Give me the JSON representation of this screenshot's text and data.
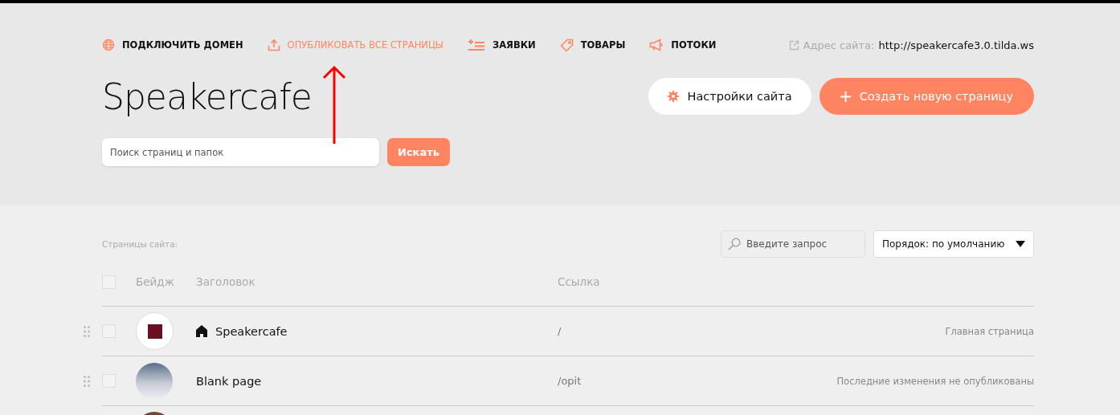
{
  "nav": [
    {
      "kind": "domain",
      "label": "ПОДКЛЮЧИТЬ ДОМЕН",
      "accent": false
    },
    {
      "kind": "publish",
      "label": "ОПУБЛИКОВАТЬ ВСЕ СТРАНИЦЫ",
      "accent": true
    },
    {
      "kind": "leads",
      "label": "ЗАЯВКИ",
      "accent": false
    },
    {
      "kind": "products",
      "label": "ТОВАРЫ",
      "accent": false
    },
    {
      "kind": "streams",
      "label": "ПОТОКИ",
      "accent": false
    }
  ],
  "site_address": {
    "label": "Адрес сайта:",
    "url": "http://speakercafe3.0.tilda.ws"
  },
  "project_title": "Speakercafe",
  "settings_button": "Настройки сайта",
  "create_button": "Создать новую страницу",
  "search": {
    "placeholder": "Поиск страниц и папок",
    "button": "Искать"
  },
  "pages_label": "Страницы сайта:",
  "filter": {
    "placeholder": "Введите запрос"
  },
  "sort": {
    "value": "Порядок: по умолчанию"
  },
  "table": {
    "select_all": {
      "checked": false
    },
    "columns": [
      "Бейдж",
      "Заголовок",
      "Ссылка"
    ],
    "rows": [
      {
        "title": "Speakercafe",
        "home": true,
        "link": "/",
        "status": "Главная страница",
        "checked": false,
        "kind": "logo"
      },
      {
        "title": "Blank page",
        "home": false,
        "link": "/opit",
        "status": "Последние изменения не опубликованы",
        "checked": false,
        "kind": "photo"
      }
    ]
  }
}
